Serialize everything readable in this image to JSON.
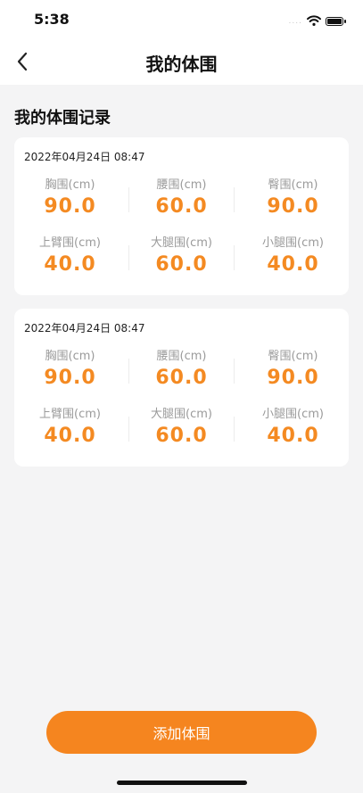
{
  "status_bar": {
    "time": "5:38",
    "signal_dots": "....",
    "wifi_icon": "wifi-icon",
    "battery_icon": "battery-icon"
  },
  "nav": {
    "back_icon": "chevron-left-icon",
    "title": "我的体围"
  },
  "section_title": "我的体围记录",
  "records": [
    {
      "date": "2022年04月24日 08:47",
      "items": [
        {
          "label": "胸围(cm)",
          "value": "90.0"
        },
        {
          "label": "腰围(cm)",
          "value": "60.0"
        },
        {
          "label": "臀围(cm)",
          "value": "90.0"
        },
        {
          "label": "上臂围(cm)",
          "value": "40.0"
        },
        {
          "label": "大腿围(cm)",
          "value": "60.0"
        },
        {
          "label": "小腿围(cm)",
          "value": "40.0"
        }
      ]
    },
    {
      "date": "2022年04月24日 08:47",
      "items": [
        {
          "label": "胸围(cm)",
          "value": "90.0"
        },
        {
          "label": "腰围(cm)",
          "value": "60.0"
        },
        {
          "label": "臀围(cm)",
          "value": "90.0"
        },
        {
          "label": "上臂围(cm)",
          "value": "40.0"
        },
        {
          "label": "大腿围(cm)",
          "value": "60.0"
        },
        {
          "label": "小腿围(cm)",
          "value": "40.0"
        }
      ]
    }
  ],
  "add_button_label": "添加体围",
  "colors": {
    "accent": "#f5851f",
    "value": "#f48a22",
    "background": "#f4f4f5",
    "card": "#ffffff",
    "label": "#9a9a9a"
  }
}
